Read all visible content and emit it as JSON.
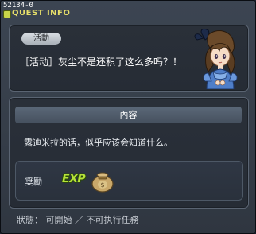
{
  "window": {
    "quest_id": "52134-0",
    "title": "QUEST INFO"
  },
  "quest": {
    "category_tag": "活動",
    "name": "［活动］灰尘不是还积了这么多吗？！",
    "npc_icon": "npc-portrait-icon"
  },
  "content": {
    "header": "內容",
    "description": "露迪米拉的话，似乎应该会知道什么。"
  },
  "reward": {
    "label": "奨勵",
    "exp_text": "EXP",
    "item_icon": "money-bag-icon"
  },
  "status": {
    "text": "狀態： 可開始 ／ 不可执行任務"
  },
  "colors": {
    "title": "#e8e06a",
    "exp": "#b6e23a",
    "panel_bg": "#262c35",
    "window_bg": "#353d48"
  }
}
